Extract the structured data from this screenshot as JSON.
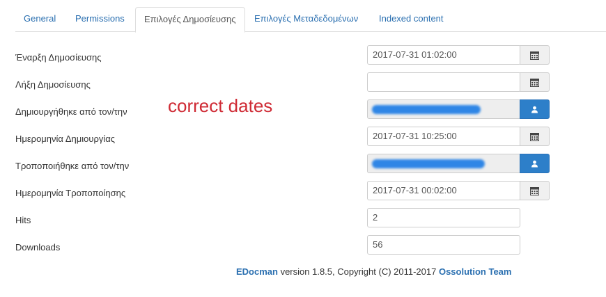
{
  "tabs": [
    {
      "label": "General"
    },
    {
      "label": "Permissions"
    },
    {
      "label": "Επιλογές Δημοσίευσης",
      "active": true
    },
    {
      "label": "Επιλογές Μεταδεδομένων"
    },
    {
      "label": "Indexed content"
    }
  ],
  "form": {
    "publish_up": {
      "label": "Έναρξη Δημοσίευσης",
      "value": "2017-07-31 01:02:00",
      "icon": "calendar-icon"
    },
    "publish_down": {
      "label": "Λήξη Δημοσίευσης",
      "value": "",
      "icon": "calendar-icon"
    },
    "created_by": {
      "label": "Δημιουργήθηκε από τον/την",
      "icon": "user-icon"
    },
    "created": {
      "label": "Ημερομηνία Δημιουργίας",
      "value": "2017-07-31 10:25:00",
      "icon": "calendar-icon"
    },
    "modified_by": {
      "label": "Τροποποιήθηκε από τον/την",
      "icon": "user-icon"
    },
    "modified": {
      "label": "Ημερομηνία Τροποποίησης",
      "value": "2017-07-31 00:02:00",
      "icon": "calendar-icon"
    },
    "hits": {
      "label": "Hits",
      "value": "2"
    },
    "downloads": {
      "label": "Downloads",
      "value": "56"
    }
  },
  "annotation": "correct dates",
  "footer": {
    "brand": "EDocman",
    "text": " version 1.8.5, Copyright (C) 2011-2017 ",
    "team": "Ossolution Team"
  },
  "colors": {
    "link": "#2a6fb0",
    "annotation": "#cf2a34",
    "user_button": "#2d7fc9"
  }
}
